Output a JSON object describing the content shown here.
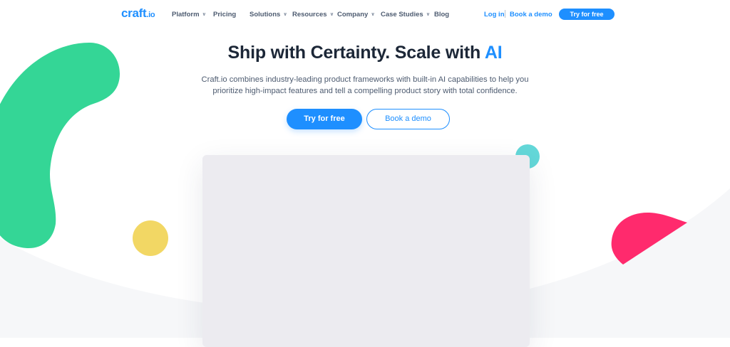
{
  "header": {
    "logo_text": "craft",
    "logo_suffix": ".io",
    "nav": [
      {
        "label": "Platform",
        "has_dropdown": true
      },
      {
        "label": "Pricing",
        "has_dropdown": false
      },
      {
        "label": "Solutions",
        "has_dropdown": true
      },
      {
        "label": "Resources",
        "has_dropdown": true
      },
      {
        "label": "Company",
        "has_dropdown": true
      },
      {
        "label": "Case Studies",
        "has_dropdown": true
      },
      {
        "label": "Blog",
        "has_dropdown": false
      }
    ],
    "login_label": "Log in",
    "book_demo_label": "Book a demo",
    "try_free_label": "Try for free"
  },
  "hero": {
    "title_main": "Ship with Certainty. Scale with ",
    "title_accent": "AI",
    "subtitle": "Craft.io combines industry-leading product frameworks with built-in AI capabilities to help you prioritize high-impact features and tell a compelling product story with total confidence.",
    "primary_cta": "Try for free",
    "secondary_cta": "Book a demo"
  },
  "colors": {
    "brand_blue": "#1e8fff",
    "green_shape": "#34d696",
    "yellow_shape": "#f2d764",
    "teal_shape": "#64d8d9",
    "pink_shape": "#ff2a6d",
    "background_curve": "#f6f7f9"
  }
}
